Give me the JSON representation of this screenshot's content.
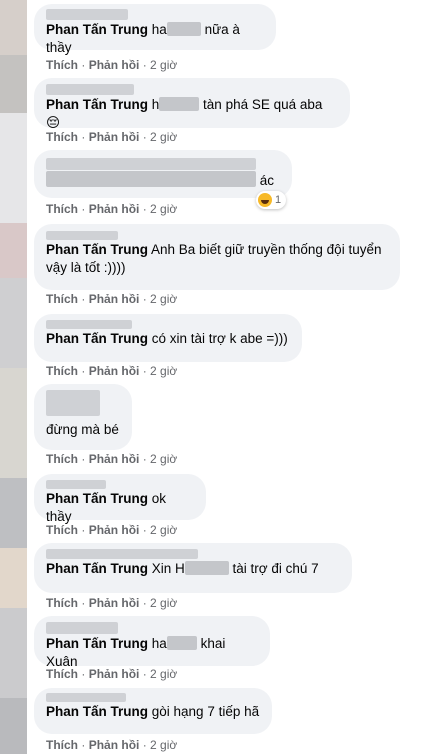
{
  "colors": {
    "bubble": "#f0f2f5",
    "text": "#050505",
    "meta": "#65676b",
    "reaction": "#f7b928"
  },
  "actions": {
    "like": "Thích",
    "reply": "Phản hồi",
    "time": "2 giờ",
    "separator": "·"
  },
  "mention": "Phan Tấn Trung",
  "comments": [
    {
      "text_before": "ha",
      "text_after": " nữa à thầy"
    },
    {
      "text_before": "h",
      "text_after": " tàn phá SE quá aba 😔"
    },
    {
      "text_after": "ác",
      "reaction_icon": "laughing-emoji-icon",
      "reaction_count": "1"
    },
    {
      "text_after": " Anh Ba biết giữ truyền thống đội tuyển vậy là tốt :))))"
    },
    {
      "text_after": " có xin tài trợ k abe =)))"
    },
    {
      "text": "đừng mà bé"
    },
    {
      "text_after": " ok thầy"
    },
    {
      "text_before": "Xin H",
      "text_after": " tài trợ đi chú 7"
    },
    {
      "text_before": "ha",
      "text_after": " khai Xuân"
    },
    {
      "text_after": " gòi hạng 7 tiếp hã"
    }
  ]
}
